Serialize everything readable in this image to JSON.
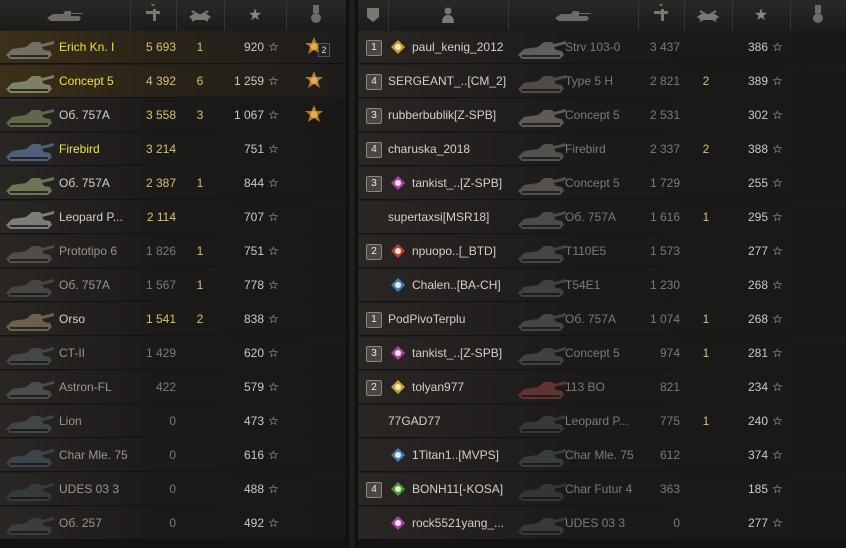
{
  "left_team": {
    "header": {
      "tank_icon": "tank-silhouette-icon",
      "damage_icon": "damage-icon",
      "kills_icon": "destroyed-tank-icon",
      "score_icon": "star-icon",
      "medal_icon": "medal-icon"
    },
    "rows": [
      {
        "name": "Erich Kn. I",
        "damage": "5 693",
        "kills": "1",
        "score": "920",
        "name_style": "gold",
        "damage_style": "gold",
        "highlight": true,
        "medal": "order-medal-icon",
        "medal_count": "2"
      },
      {
        "name": "Concept 5",
        "damage": "4 392",
        "kills": "6",
        "score": "1 259",
        "name_style": "gold",
        "damage_style": "gold",
        "highlight": true,
        "medal": "order-medal-icon"
      },
      {
        "name": "Об. 757А",
        "damage": "3 558",
        "kills": "3",
        "score": "1 067",
        "name_style": "white",
        "damage_style": "gold",
        "highlight": false,
        "medal": "order-medal-icon"
      },
      {
        "name": "Firebird",
        "damage": "3 214",
        "kills": "",
        "score": "751",
        "name_style": "gold",
        "damage_style": "gold",
        "highlight": false,
        "medal": ""
      },
      {
        "name": "Об. 757А",
        "damage": "2 387",
        "kills": "1",
        "score": "844",
        "name_style": "white",
        "damage_style": "gold",
        "highlight": false,
        "medal": ""
      },
      {
        "name": "Leopard P...",
        "damage": "2 114",
        "kills": "",
        "score": "707",
        "name_style": "white",
        "damage_style": "gold",
        "highlight": false,
        "medal": ""
      },
      {
        "name": "Prototipo 6",
        "damage": "1 826",
        "kills": "1",
        "score": "751",
        "name_style": "grey",
        "damage_style": "mute",
        "highlight": false,
        "medal": ""
      },
      {
        "name": "Об. 757А",
        "damage": "1 567",
        "kills": "1",
        "score": "778",
        "name_style": "grey",
        "damage_style": "mute",
        "highlight": false,
        "medal": ""
      },
      {
        "name": "Orso",
        "damage": "1 541",
        "kills": "2",
        "score": "838",
        "name_style": "white",
        "damage_style": "gold",
        "highlight": false,
        "medal": ""
      },
      {
        "name": "CT-II",
        "damage": "1 429",
        "kills": "",
        "score": "620",
        "name_style": "grey",
        "damage_style": "mute",
        "highlight": false,
        "medal": ""
      },
      {
        "name": "Astron-FL",
        "damage": "422",
        "kills": "",
        "score": "579",
        "name_style": "grey",
        "damage_style": "mute",
        "highlight": false,
        "medal": ""
      },
      {
        "name": "Lion",
        "damage": "0",
        "kills": "",
        "score": "473",
        "name_style": "grey",
        "damage_style": "mute",
        "highlight": false,
        "medal": ""
      },
      {
        "name": "Char Mle. 75",
        "damage": "0",
        "kills": "",
        "score": "616",
        "name_style": "grey",
        "damage_style": "mute",
        "highlight": false,
        "medal": ""
      },
      {
        "name": "UDES 03 3",
        "damage": "0",
        "kills": "",
        "score": "488",
        "name_style": "grey",
        "damage_style": "mute",
        "highlight": false,
        "medal": ""
      },
      {
        "name": "Об. 257",
        "damage": "0",
        "kills": "",
        "score": "492",
        "name_style": "grey",
        "damage_style": "mute",
        "highlight": false,
        "medal": ""
      }
    ]
  },
  "right_team": {
    "header": {
      "platoon_icon": "platoon-shield-icon",
      "player_icon": "player-silhouette-icon",
      "tank_icon": "tank-silhouette-icon",
      "damage_icon": "damage-icon",
      "kills_icon": "destroyed-tank-icon",
      "score_icon": "star-icon",
      "medal_icon": "medal-icon"
    },
    "rows": [
      {
        "platoon": "1",
        "clan_icon": "clan-emblem-icon",
        "player": "paul_kenig_2012",
        "tank": "Strv 103-0",
        "damage": "3 437",
        "kills": "",
        "score": "386"
      },
      {
        "platoon": "4",
        "clan_icon": "",
        "player": "SERGEANT_..[CM_2]",
        "tank": "Type 5 H",
        "damage": "2 821",
        "kills": "2",
        "score": "389"
      },
      {
        "platoon": "3",
        "clan_icon": "",
        "player": "rubberbublik[Z-SPB]",
        "tank": "Concept 5",
        "damage": "2 531",
        "kills": "",
        "score": "302"
      },
      {
        "platoon": "4",
        "clan_icon": "",
        "player": "charuska_2018",
        "tank": "Firebird",
        "damage": "2 337",
        "kills": "2",
        "score": "388"
      },
      {
        "platoon": "3",
        "clan_icon": "clan-emblem-icon",
        "player": "tankist_..[Z-SPB]",
        "tank": "Concept 5",
        "damage": "1 729",
        "kills": "",
        "score": "255"
      },
      {
        "platoon": "",
        "clan_icon": "",
        "player": "supertaxsi[MSR18]",
        "tank": "Об. 757А",
        "damage": "1 616",
        "kills": "1",
        "score": "295"
      },
      {
        "platoon": "2",
        "clan_icon": "clan-emblem-icon",
        "player": "npuopo..[_BTD]",
        "tank": "T110E5",
        "damage": "1 573",
        "kills": "",
        "score": "277"
      },
      {
        "platoon": "",
        "clan_icon": "clan-emblem-icon",
        "player": "Chalen..[BA-CH]",
        "tank": "T54E1",
        "damage": "1 230",
        "kills": "",
        "score": "268"
      },
      {
        "platoon": "1",
        "clan_icon": "",
        "player": "PodPivoTerplu",
        "tank": "Об. 757А",
        "damage": "1 074",
        "kills": "1",
        "score": "268"
      },
      {
        "platoon": "3",
        "clan_icon": "clan-emblem-icon",
        "player": "tankist_..[Z-SPB]",
        "tank": "Concept 5",
        "damage": "974",
        "kills": "1",
        "score": "281"
      },
      {
        "platoon": "2",
        "clan_icon": "clan-emblem-icon",
        "player": "tolyan977",
        "tank": "113 BO",
        "damage": "821",
        "kills": "",
        "score": "234"
      },
      {
        "platoon": "",
        "clan_icon": "",
        "player": "77GAD77",
        "tank": "Leopard P...",
        "damage": "775",
        "kills": "1",
        "score": "240"
      },
      {
        "platoon": "",
        "clan_icon": "clan-emblem-icon",
        "player": "1Titan1..[MVPS]",
        "tank": "Char Mle. 75",
        "damage": "612",
        "kills": "",
        "score": "374"
      },
      {
        "platoon": "4",
        "clan_icon": "clan-emblem-icon",
        "player": "BONH11[-KOSA]",
        "tank": "Char Futur 4",
        "damage": "363",
        "kills": "",
        "score": "185"
      },
      {
        "platoon": "",
        "clan_icon": "clan-emblem-icon",
        "player": "rock5521yang_...",
        "tank": "UDES 03 3",
        "damage": "0",
        "kills": "",
        "score": "277"
      }
    ]
  },
  "colors": {
    "name_gold": "#f0e23a",
    "value_gold": "#d8c070",
    "text_white": "#d4d0c8",
    "text_muted": "#7e7a74",
    "highlight_row": "#3d3018"
  }
}
